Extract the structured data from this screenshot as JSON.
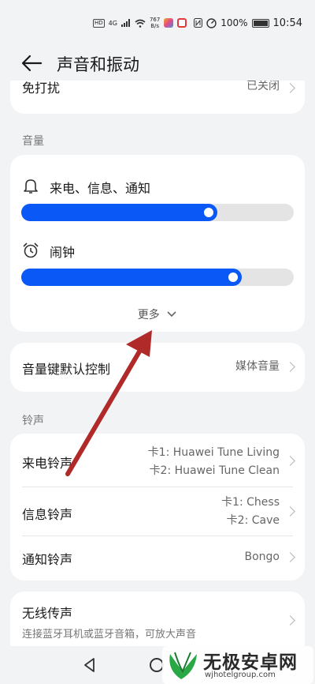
{
  "status_bar": {
    "hd_badge": "HD",
    "network": "4G",
    "speed_value": "767",
    "speed_unit": "B/s",
    "battery_percent": "100%",
    "time": "10:54"
  },
  "header": {
    "title": "声音和振动"
  },
  "top_partial_row": {
    "label": "免打扰",
    "value": "已关闭"
  },
  "volume_section": {
    "label": "音量",
    "ringer": {
      "label": "来电、信息、通知",
      "level": 0.72
    },
    "alarm": {
      "label": "闹钟",
      "level": 0.81
    },
    "more_label": "更多"
  },
  "volume_key_row": {
    "label": "音量键默认控制",
    "value": "媒体音量"
  },
  "ringtone_section": {
    "label": "铃声",
    "call_ringtone": {
      "label": "来电铃声",
      "value_line1": "卡1: Huawei Tune Living",
      "value_line2": "卡2: Huawei Tune Clean"
    },
    "message_ringtone": {
      "label": "信息铃声",
      "value_line1": "卡1: Chess",
      "value_line2": "卡2: Cave"
    },
    "notification_ringtone": {
      "label": "通知铃声",
      "value": "Bongo"
    }
  },
  "wireless_row": {
    "label": "无线传声",
    "description": "连接蓝牙耳机或蓝牙音箱，可放大声音"
  },
  "watermark": {
    "title": "无极安卓网",
    "url": "wjhotelgroup.com"
  },
  "colors": {
    "accent": "#0a59f7",
    "annotation_arrow": "#b02a2a"
  }
}
